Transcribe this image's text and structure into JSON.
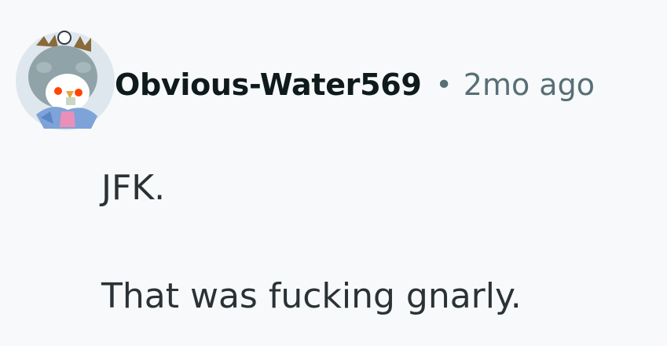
{
  "comment": {
    "author": "Obvious-Water569",
    "separator": "•",
    "timestamp": "2mo ago",
    "avatar_icon": "snoo-avatar-icon",
    "body_paragraphs": [
      "JFK.",
      "That was fucking gnarly."
    ]
  },
  "colors": {
    "background": "#f8f9fa",
    "username": "#0f1a1c",
    "meta_gray": "#576f76",
    "body_text": "#2a3236"
  }
}
